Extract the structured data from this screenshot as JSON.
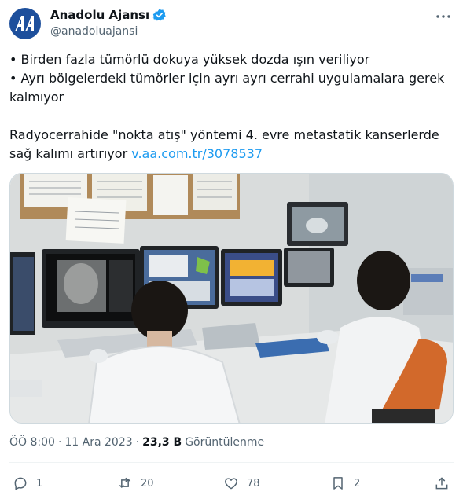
{
  "account": {
    "name": "Anadolu Ajansı",
    "handle": "@anadoluajansi",
    "avatar_text": "AA"
  },
  "tweet": {
    "bullet1": "• Birden fazla tümörlü dokuya yüksek dozda ışın veriliyor",
    "bullet2": "• Ayrı bölgelerdeki tümörler için ayrı ayrı cerrahi uygulamalara gerek kalmıyor",
    "headline": "Radyocerrahide \"nokta atış\" yöntemi 4. evre metastatik kanserlerde sağ kalımı artırıyor",
    "link": "v.aa.com.tr/3078537"
  },
  "meta": {
    "time": "ÖÖ 8:00",
    "separator": "·",
    "date": "11 Ara 2023",
    "views_count": "23,3 B",
    "views_label": "Görüntülenme"
  },
  "actions": {
    "replies": "1",
    "reposts": "20",
    "likes": "78",
    "bookmarks": "2"
  },
  "colors": {
    "link": "#1d9bf0",
    "verified": "#1d9bf0",
    "avatar_bg": "#1d4f9c",
    "secondary_text": "#536471"
  }
}
